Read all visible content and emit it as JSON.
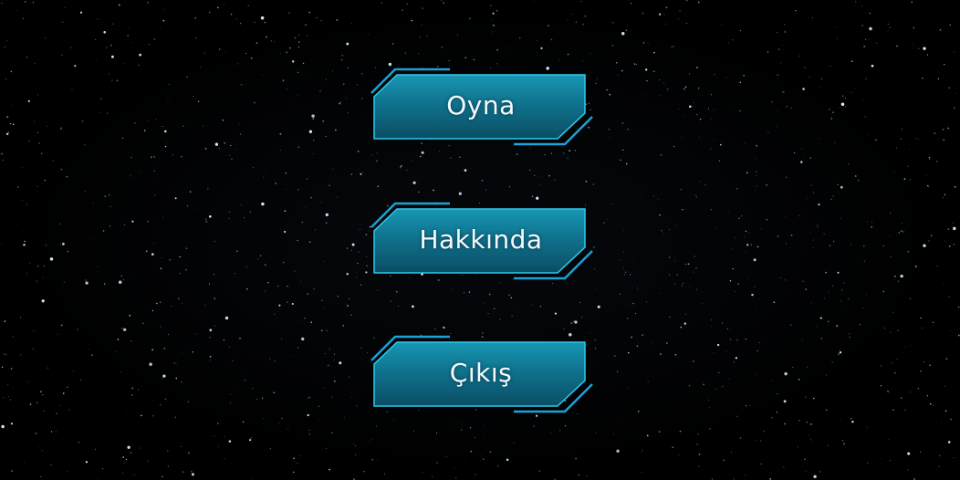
{
  "menu": {
    "play_label": "Oyna",
    "about_label": "Hakkında",
    "exit_label": "Çıkış"
  },
  "colors": {
    "background": "#000000",
    "button_fill_top": "#137d96",
    "button_fill_bottom": "#0a4f66",
    "button_border": "#2fc9ee",
    "accent_line": "#1aa3d6",
    "label_text": "#f4fbff",
    "star": "#cfefff"
  }
}
